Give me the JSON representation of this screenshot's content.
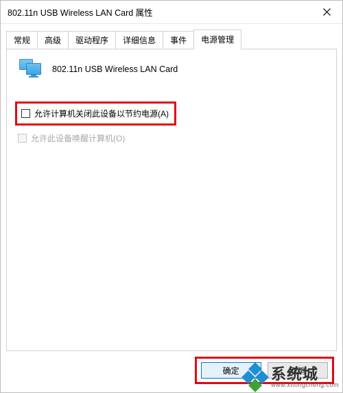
{
  "window": {
    "title": "802.11n USB Wireless LAN Card 属性"
  },
  "tabs": [
    {
      "label": "常规"
    },
    {
      "label": "高级"
    },
    {
      "label": "驱动程序"
    },
    {
      "label": "详细信息"
    },
    {
      "label": "事件"
    },
    {
      "label": "电源管理",
      "active": true
    }
  ],
  "pane": {
    "device_name": "802.11n USB Wireless LAN Card",
    "checkbox_power_save": {
      "label": "允许计算机关闭此设备以节约电源(A)",
      "checked": false,
      "highlighted": true
    },
    "checkbox_wake": {
      "label": "允许此设备唤醒计算机(O)",
      "checked": false,
      "disabled": true
    }
  },
  "footer": {
    "ok_label": "确定",
    "cancel_label": "取消",
    "highlighted": true
  },
  "watermark": {
    "text_cn": "系统城",
    "text_en": "www.xitongcheng.com"
  }
}
